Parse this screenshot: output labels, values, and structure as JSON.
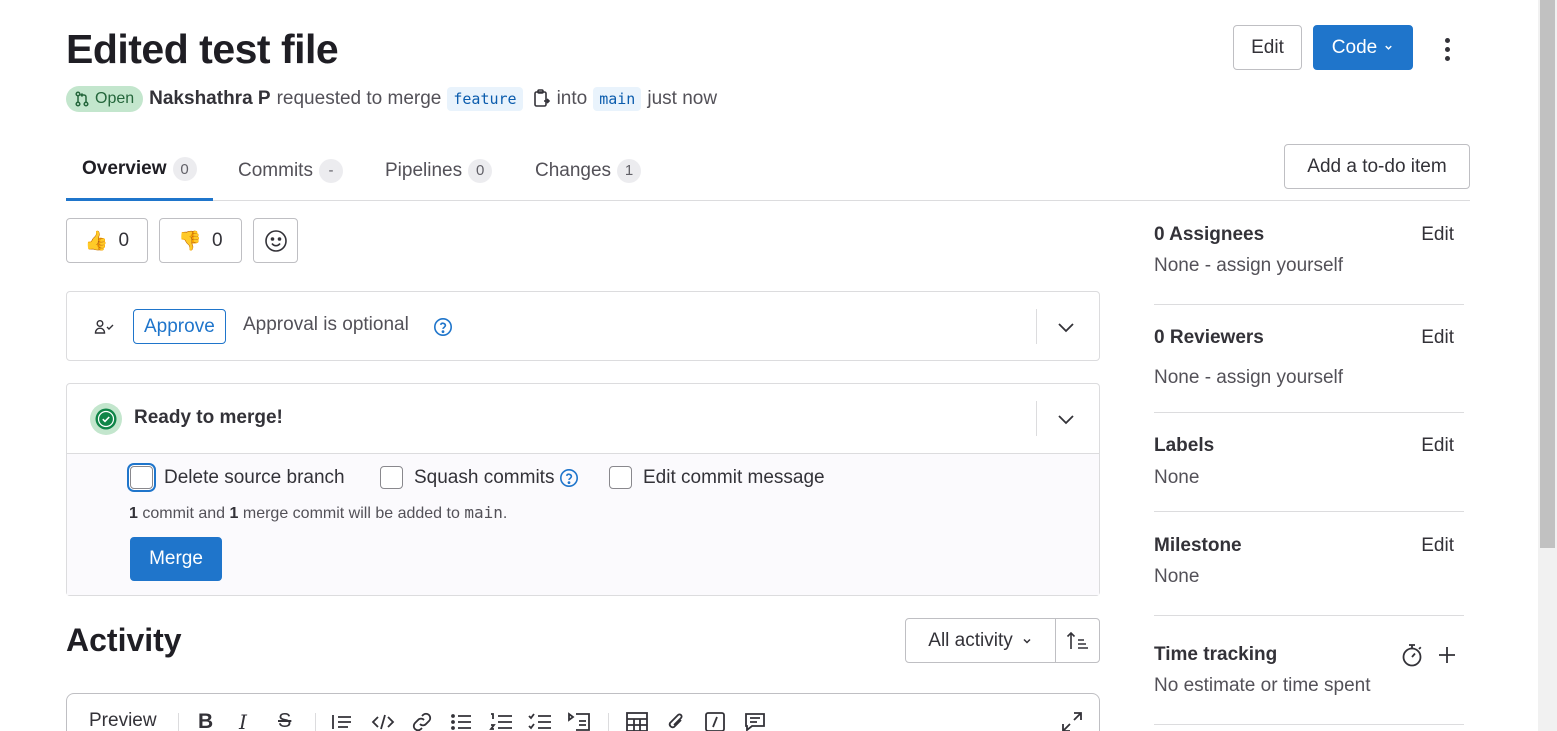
{
  "header": {
    "title": "Edited test file",
    "status": "Open",
    "author": "Nakshathra P",
    "requested_text": "requested to merge",
    "source_branch": "feature",
    "into_text": "into",
    "target_branch": "main",
    "time": "just now",
    "edit_label": "Edit",
    "code_label": "Code"
  },
  "tabs": [
    {
      "label": "Overview",
      "count": "0"
    },
    {
      "label": "Commits",
      "count": "-"
    },
    {
      "label": "Pipelines",
      "count": "0"
    },
    {
      "label": "Changes",
      "count": "1"
    }
  ],
  "todo_label": "Add a to-do item",
  "reactions": {
    "thumbs_up": "0",
    "thumbs_down": "0"
  },
  "approval": {
    "button": "Approve",
    "text": "Approval is optional"
  },
  "merge": {
    "title": "Ready to merge!",
    "options": [
      "Delete source branch",
      "Squash commits",
      "Edit commit message"
    ],
    "note_count1": "1",
    "note_mid": "commit and",
    "note_count2": "1",
    "note_tail": "merge commit will be added to",
    "note_branch": "main",
    "note_end": ".",
    "button": "Merge"
  },
  "activity": {
    "title": "Activity",
    "filter": "All activity"
  },
  "editor": {
    "preview_label": "Preview"
  },
  "sidebar": {
    "edit_label": "Edit",
    "assignees_title": "0 Assignees",
    "assignees_value": "None - assign yourself",
    "reviewers_title": "0 Reviewers",
    "reviewers_value": "None - assign yourself",
    "labels_title": "Labels",
    "labels_value": "None",
    "milestone_title": "Milestone",
    "milestone_value": "None",
    "time_title": "Time tracking",
    "time_value": "No estimate or time spent"
  },
  "colors": {
    "primary": "#1f75cb",
    "success": "#108548",
    "open_badge_bg": "#c3e6cd"
  }
}
